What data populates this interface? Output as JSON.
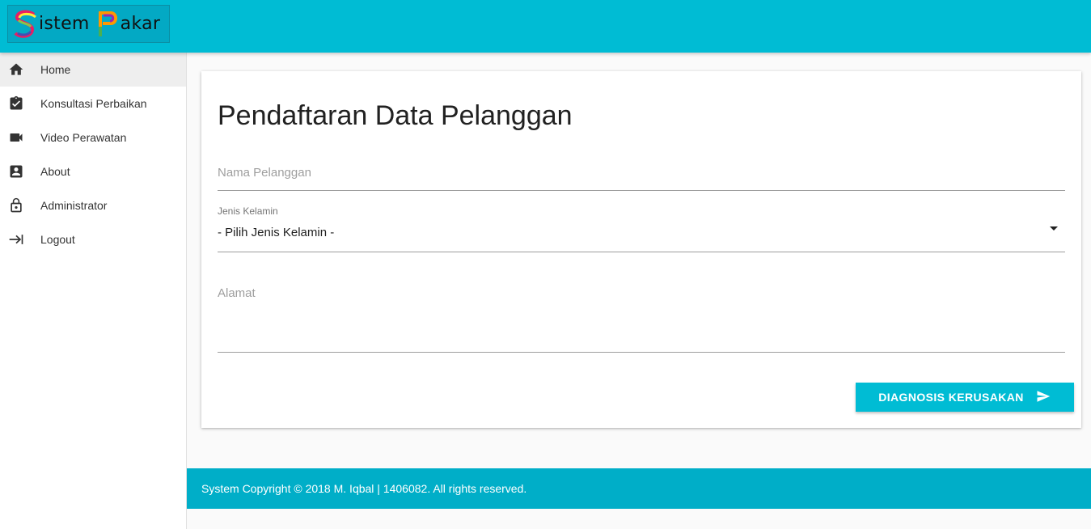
{
  "header": {
    "logo_text": "Sistem Pakar",
    "logo_word_1": "istem",
    "logo_word_2": "akar",
    "background_color": "#00bcd4"
  },
  "sidebar": {
    "items": [
      {
        "label": "Home",
        "icon": "home-icon",
        "active": true
      },
      {
        "label": "Konsultasi Perbaikan",
        "icon": "clipboard-check-icon",
        "active": false
      },
      {
        "label": "Video Perawatan",
        "icon": "video-camera-icon",
        "active": false
      },
      {
        "label": "About",
        "icon": "account-box-icon",
        "active": false
      },
      {
        "label": "Administrator",
        "icon": "lock-icon",
        "active": false
      },
      {
        "label": "Logout",
        "icon": "logout-arrow-icon",
        "active": false
      }
    ]
  },
  "form": {
    "title": "Pendaftaran Data Pelanggan",
    "nama_placeholder": "Nama Pelanggan",
    "jenis_kelamin_label": "Jenis Kelamin",
    "jenis_kelamin_value": "- Pilih Jenis Kelamin -",
    "alamat_placeholder": "Alamat",
    "submit_label": "DIAGNOSIS KERUSAKAN",
    "submit_icon": "send-icon"
  },
  "footer": {
    "text": "System Copyright © 2018 M. Iqbal | 1406082. All rights reserved."
  },
  "colors": {
    "accent": "#00bcd4",
    "footer": "#00aec8"
  }
}
